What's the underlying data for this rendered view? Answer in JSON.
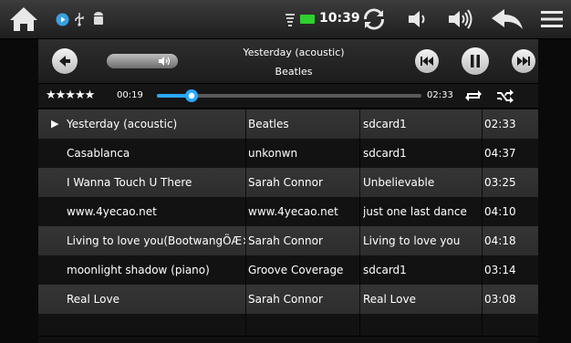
{
  "status_bar": {
    "icons_left": [
      "home-icon",
      "media-play-notification-icon",
      "usb-icon",
      "android-debug-icon"
    ],
    "icons_right": [
      "wifi-signal-icon",
      "battery-icon",
      "sync-icon",
      "volume-down-icon",
      "volume-up-icon",
      "back-icon",
      "menu-icon"
    ],
    "time": "10:39"
  },
  "player": {
    "title": "Yesterday (acoustic)",
    "artist": "Beatles",
    "rating": "★★★★★",
    "elapsed": "00:19",
    "total": "02:33",
    "progress_fraction": 0.13
  },
  "playlist": [
    {
      "title": "Yesterday (acoustic)",
      "artist": "Beatles",
      "album": "sdcard1",
      "duration": "02:33",
      "playing": "▶"
    },
    {
      "title": "Casablanca",
      "artist": "unkonwn",
      "album": "sdcard1",
      "duration": "04:37"
    },
    {
      "title": "I Wanna Touch U There",
      "artist": "Sarah Connor",
      "album": "Unbelievable",
      "duration": "03:25"
    },
    {
      "title": "www.4yecao.net",
      "artist": "www.4yecao.net",
      "album": "just one last dance",
      "duration": "04:10"
    },
    {
      "title": "Living to love you(BootwangÖÆ×÷)",
      "artist": "Sarah Connor",
      "album": "Living to love you",
      "duration": "04:18"
    },
    {
      "title": "moonlight shadow (piano)",
      "artist": "Groove Coverage",
      "album": "sdcard1",
      "duration": "03:14"
    },
    {
      "title": "Real Love",
      "artist": "Sarah Connor",
      "album": "Real Love",
      "duration": "03:08"
    }
  ],
  "colors": {
    "accent": "#2aa7ff",
    "row_light": "#323232",
    "row_dark": "#121212"
  }
}
